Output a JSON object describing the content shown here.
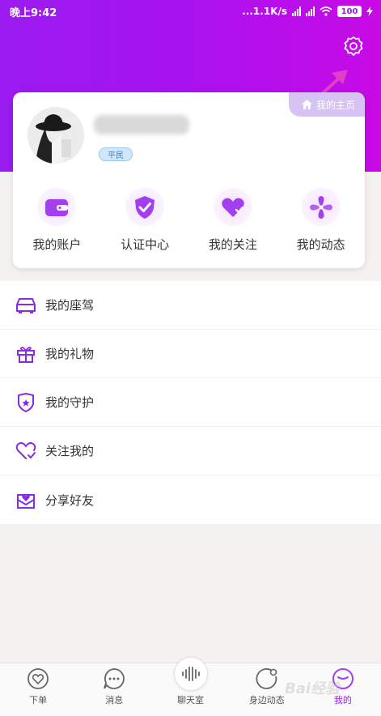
{
  "status_bar": {
    "time": "晚上9:42",
    "network_speed": "...1.1K/s",
    "battery": "100"
  },
  "header": {
    "settings_icon": "gear-icon"
  },
  "profile": {
    "homepage_label": "我的主页",
    "rank_badge": "平民"
  },
  "quick_actions": [
    {
      "label": "我的账户",
      "icon": "wallet-icon"
    },
    {
      "label": "认证中心",
      "icon": "shield-check-icon"
    },
    {
      "label": "我的关注",
      "icon": "heart-check-icon"
    },
    {
      "label": "我的动态",
      "icon": "pinwheel-icon"
    }
  ],
  "menu": [
    {
      "label": "我的座驾",
      "icon": "car-icon"
    },
    {
      "label": "我的礼物",
      "icon": "gift-icon"
    },
    {
      "label": "我的守护",
      "icon": "guard-badge-icon"
    },
    {
      "label": "关注我的",
      "icon": "heart-follow-icon"
    },
    {
      "label": "分享好友",
      "icon": "share-envelope-icon"
    }
  ],
  "bottom_nav": [
    {
      "label": "下单",
      "icon": "order-heart-icon"
    },
    {
      "label": "消息",
      "icon": "message-icon"
    },
    {
      "label": "聊天室",
      "icon": "voice-wave-icon"
    },
    {
      "label": "身边动态",
      "icon": "nearby-icon"
    },
    {
      "label": "我的",
      "icon": "profile-icon"
    }
  ],
  "watermark": "Bai经验",
  "colors": {
    "accent": "#9a1bf0",
    "accent_light": "#b04ee8",
    "arrow": "#e040c8"
  }
}
